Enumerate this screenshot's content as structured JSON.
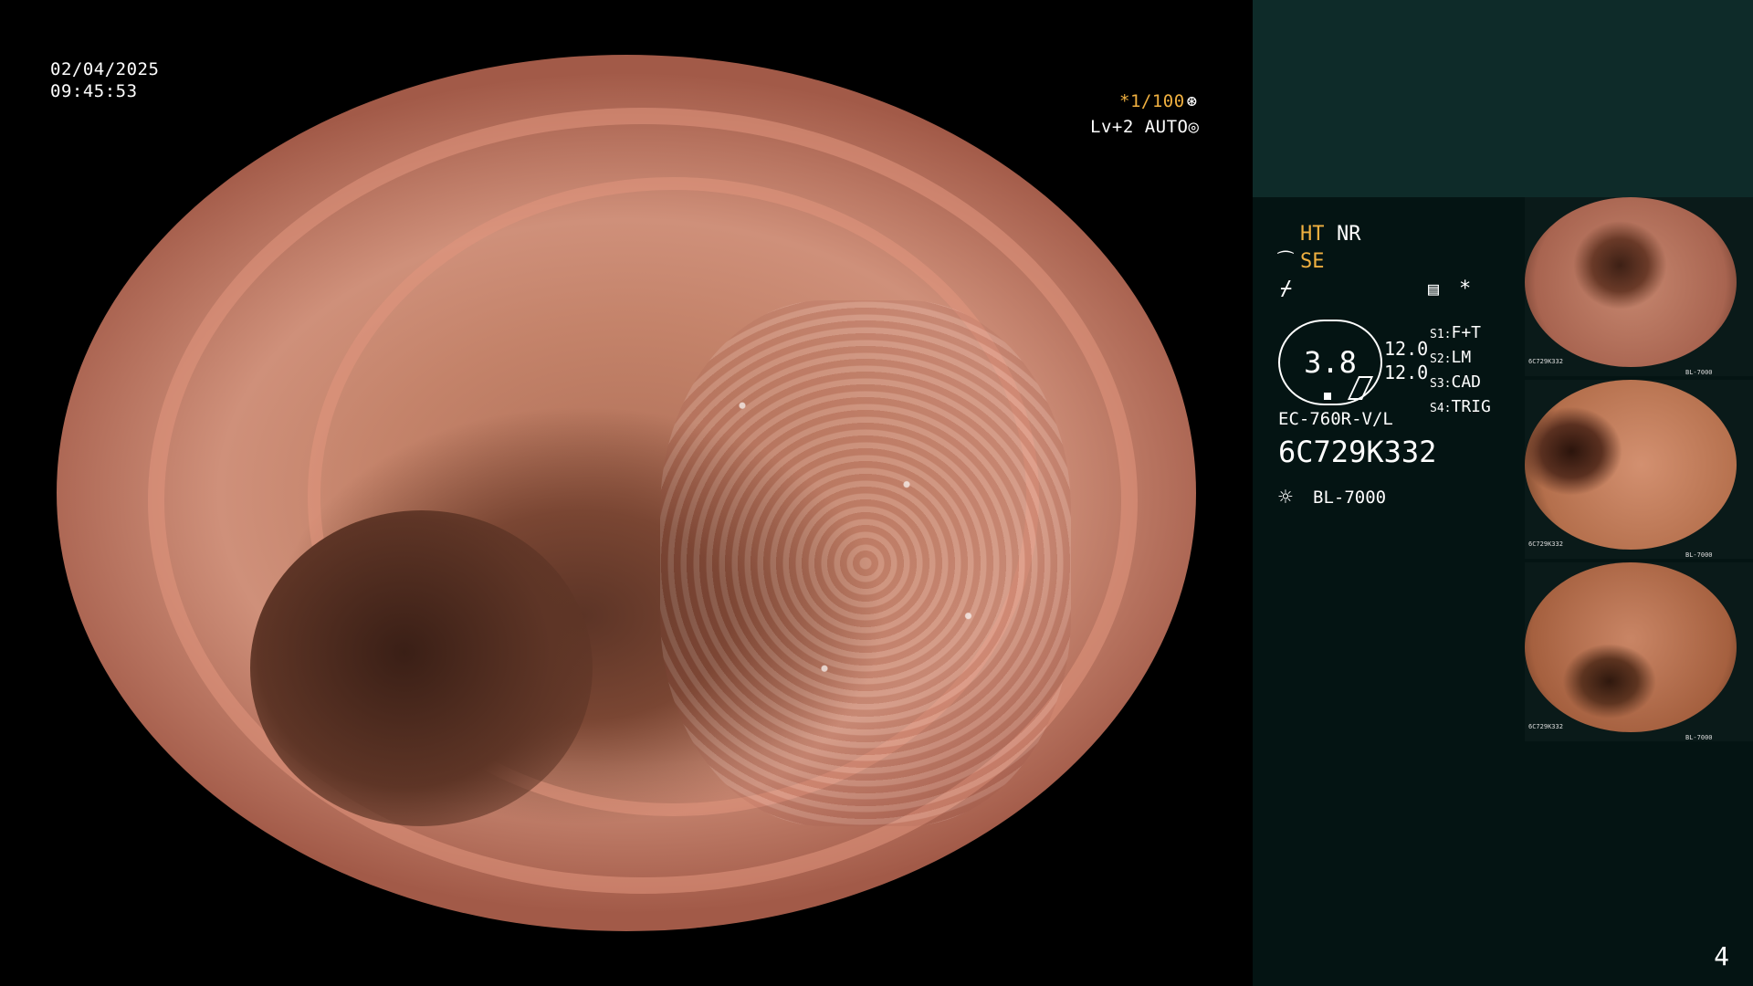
{
  "scope": {
    "date": "02/04/2025",
    "time": "09:45:53",
    "shutter": "*1/100",
    "shutter_icon": "⊛",
    "level": "Lv+2 AUTO",
    "level_icon": "◎"
  },
  "panel": {
    "ht": "HT",
    "nr": "NR",
    "se_icon": "⁀",
    "se": "SE",
    "mode_icon": "⌿",
    "memo_icon": "▤",
    "star": "*",
    "gauge_value": "3.8",
    "gauge_right_1": "12.0",
    "gauge_right_2": "12.0",
    "switches": [
      {
        "key": "S1:",
        "value": "F+T"
      },
      {
        "key": "S2:",
        "value": "LM"
      },
      {
        "key": "S3:",
        "value": "CAD"
      },
      {
        "key": "S4:",
        "value": "TRIG"
      }
    ],
    "scope_model": "EC-760R-V/L",
    "serial": "6C729K332",
    "light_icon": "☼",
    "light_source": "BL-7000"
  },
  "thumbnails": [
    {
      "caption": "6C729K332",
      "footer": "BL-7000"
    },
    {
      "caption": "6C729K332",
      "footer": "BL-7000"
    },
    {
      "caption": "6C729K332",
      "footer": "BL-7000"
    }
  ],
  "page_number": "4"
}
